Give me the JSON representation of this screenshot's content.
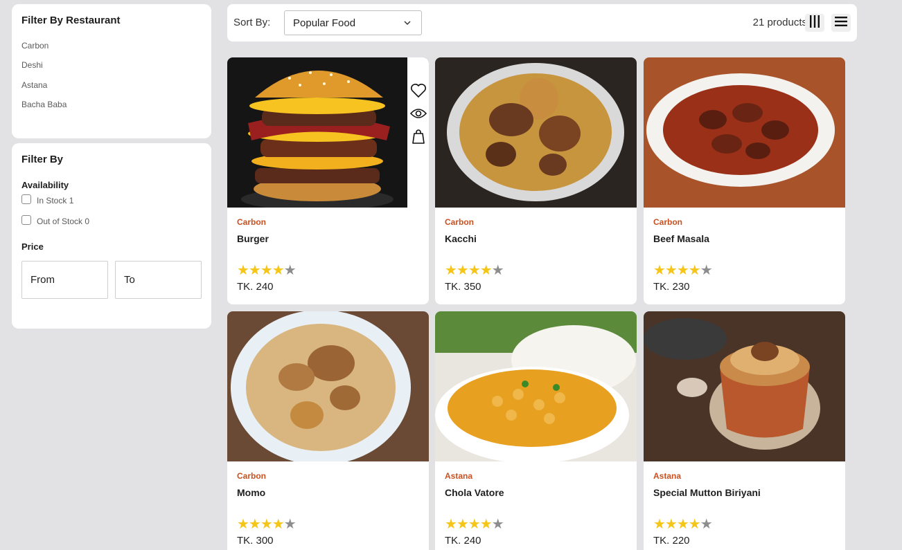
{
  "sidebar": {
    "restaurant_title": "Filter By Restaurant",
    "restaurants": [
      "Carbon",
      "Deshi",
      "Astana",
      "Bacha Baba"
    ],
    "filter_title": "Filter By",
    "availability_title": "Availability",
    "in_stock": "In Stock 1",
    "out_of_stock": "Out of Stock 0",
    "price_title": "Price",
    "price_from_placeholder": "From",
    "price_to_placeholder": "To"
  },
  "toolbar": {
    "sort_label": "Sort By:",
    "sort_value": "Popular Food",
    "product_count": "21 products",
    "grid_icon": "grid-view-icon",
    "list_icon": "list-view-icon"
  },
  "products": [
    {
      "restaurant": "Carbon",
      "name": "Burger",
      "rating": 4,
      "price": "TK. 240",
      "image": "burger"
    },
    {
      "restaurant": "Carbon",
      "name": "Kacchi",
      "rating": 4,
      "price": "TK. 350",
      "image": "kacchi"
    },
    {
      "restaurant": "Carbon",
      "name": "Beef Masala",
      "rating": 4,
      "price": "TK. 230",
      "image": "beef-masala"
    },
    {
      "restaurant": "Carbon",
      "name": "Momo",
      "rating": 4,
      "price": "TK. 300",
      "image": "momo"
    },
    {
      "restaurant": "Astana",
      "name": "Chola Vatore",
      "rating": 4,
      "price": "TK. 240",
      "image": "chola"
    },
    {
      "restaurant": "Astana",
      "name": "Special Mutton Biriyani",
      "rating": 4,
      "price": "TK. 220",
      "image": "biriyani"
    }
  ],
  "card_actions": [
    "heart-icon",
    "eye-icon",
    "shopping-bag-icon"
  ],
  "colors": {
    "restaurant_accent": "#c9501f",
    "star": "#f5c518",
    "star_empty": "#8d8d8d",
    "page_bg": "#e2e2e4"
  }
}
